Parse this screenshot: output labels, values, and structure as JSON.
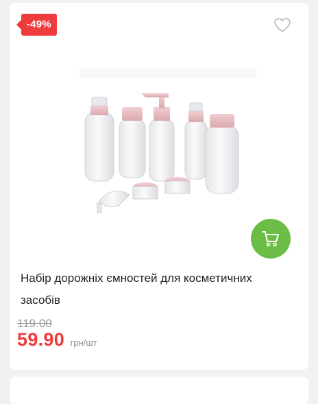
{
  "product": {
    "discount_badge": "-49%",
    "title": "Набір дорожніх ємностей для косметичних засобів",
    "old_price": "119.00",
    "price": "59.90",
    "unit": "грн/шт",
    "image_alt": "Набір дорожніх ємностей для косметичних засобів"
  },
  "icons": {
    "favorite": "heart-outline-icon",
    "cart": "cart-icon"
  },
  "colors": {
    "accent_red": "#ee3b3b",
    "cart_green": "#6cbd45",
    "old_price_gray": "#9a9a9a",
    "card_bg": "#ffffff",
    "page_bg": "#f1f1f1"
  }
}
